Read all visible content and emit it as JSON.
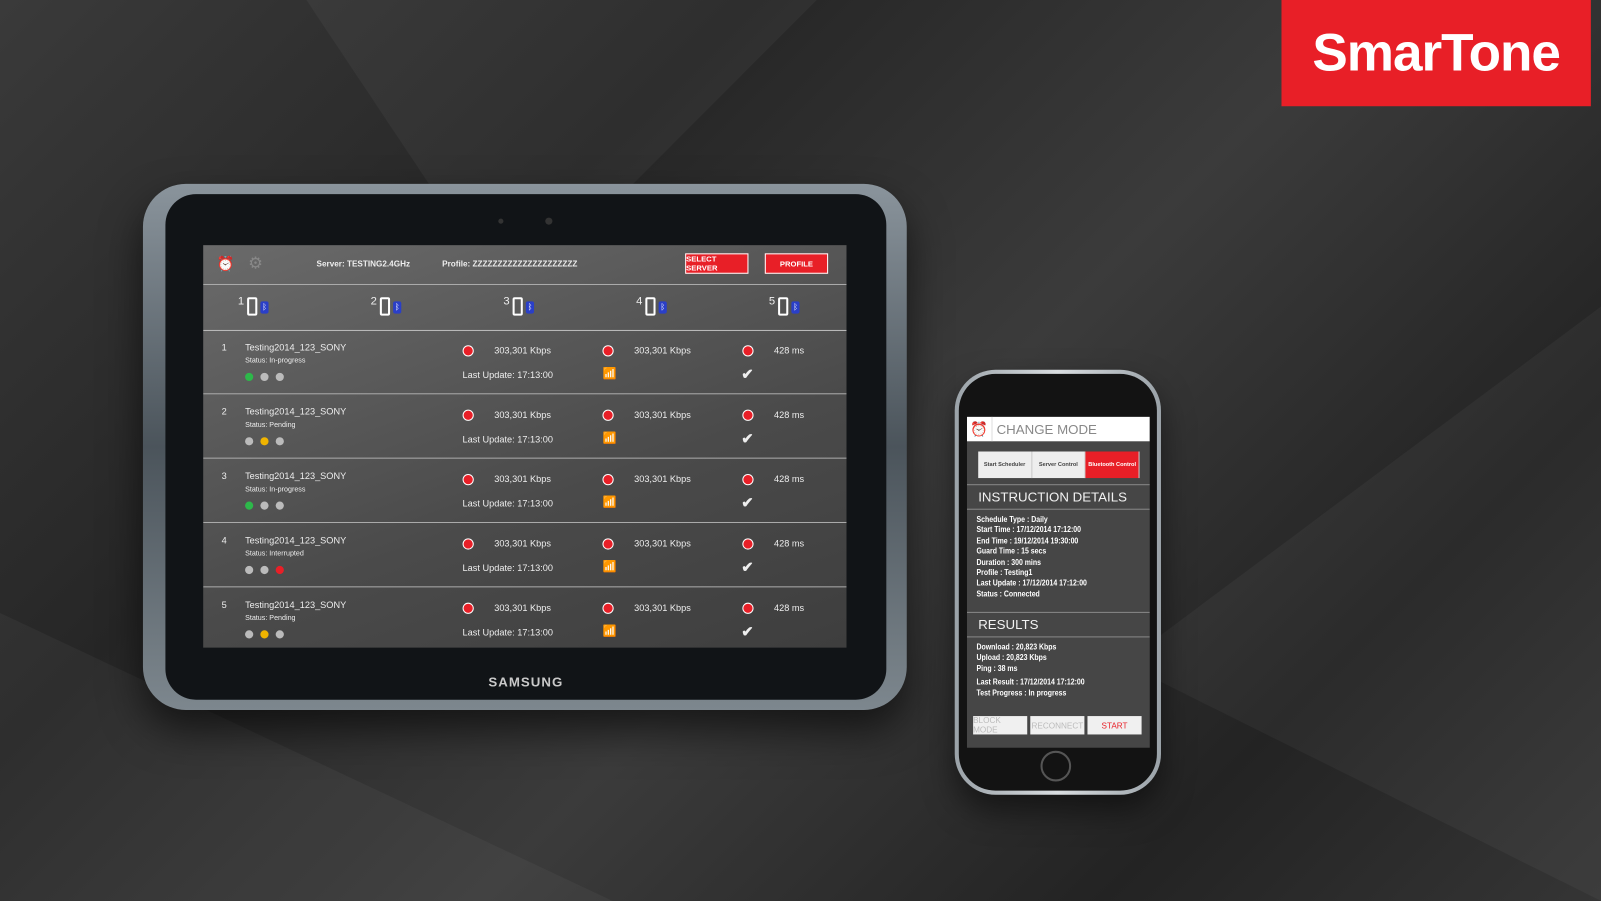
{
  "brand": {
    "logo": "SmarTone",
    "color": "#e81f27"
  },
  "tablet": {
    "device_brand": "SAMSUNG",
    "header": {
      "server": "Server: TESTING2.4GHz",
      "profile": "Profile: ZZZZZZZZZZZZZZZZZZZZZ",
      "select_server": "SELECT SERVER",
      "profile_btn": "PROFILE"
    },
    "devices": [
      {
        "n": "1"
      },
      {
        "n": "2"
      },
      {
        "n": "3"
      },
      {
        "n": "4"
      },
      {
        "n": "5"
      }
    ],
    "rows": [
      {
        "idx": "1",
        "name": "Testing2014_123_SONY",
        "status": "Status: In-progress",
        "dots": [
          "#2db84a",
          "#bbbbbb",
          "#bbbbbb"
        ],
        "download": "303,301 Kbps",
        "upload": "303,301 Kbps",
        "ping": "428 ms",
        "last_update": "Last Update: 17:13:00"
      },
      {
        "idx": "2",
        "name": "Testing2014_123_SONY",
        "status": "Status: Pending",
        "dots": [
          "#bbbbbb",
          "#f0b400",
          "#bbbbbb"
        ],
        "download": "303,301 Kbps",
        "upload": "303,301 Kbps",
        "ping": "428 ms",
        "last_update": "Last Update: 17:13:00"
      },
      {
        "idx": "3",
        "name": "Testing2014_123_SONY",
        "status": "Status: In-progress",
        "dots": [
          "#2db84a",
          "#bbbbbb",
          "#bbbbbb"
        ],
        "download": "303,301 Kbps",
        "upload": "303,301 Kbps",
        "ping": "428 ms",
        "last_update": "Last Update: 17:13:00"
      },
      {
        "idx": "4",
        "name": "Testing2014_123_SONY",
        "status": "Status: Interrupted",
        "dots": [
          "#bbbbbb",
          "#bbbbbb",
          "#e81f27"
        ],
        "download": "303,301 Kbps",
        "upload": "303,301 Kbps",
        "ping": "428 ms",
        "last_update": "Last Update: 17:13:00"
      },
      {
        "idx": "5",
        "name": "Testing2014_123_SONY",
        "status": "Status: Pending",
        "dots": [
          "#bbbbbb",
          "#f0b400",
          "#bbbbbb"
        ],
        "download": "303,301 Kbps",
        "upload": "303,301 Kbps",
        "ping": "428 ms",
        "last_update": "Last Update: 17:13:00"
      }
    ]
  },
  "phone": {
    "title": "CHANGE MODE",
    "modes": [
      "Start Scheduler",
      "Server Control",
      "Bluetooth Control"
    ],
    "active_mode": "Bluetooth Control",
    "instruction_title": "INSTRUCTION DETAILS",
    "instructions": [
      "Schedule Type : Daily",
      "Start Time : 17/12/2014 17:12:00",
      "End Time : 19/12/2014 19:30:00",
      "Guard Time : 15 secs",
      "Duration : 300 mins",
      "Profile : Testing1",
      "Last Update : 17/12/2014 17:12:00",
      "Status : Connected"
    ],
    "results_title": "RESULTS",
    "results": [
      "Download : 20,823 Kbps",
      "Upload : 20,823 Kbps",
      "Ping : 38 ms"
    ],
    "results2": [
      "Last Result : 17/12/2014 17:12:00",
      "Test Progress : In progress"
    ],
    "buttons": [
      "BLOCK MODE",
      "RECONNECT",
      "START"
    ]
  }
}
